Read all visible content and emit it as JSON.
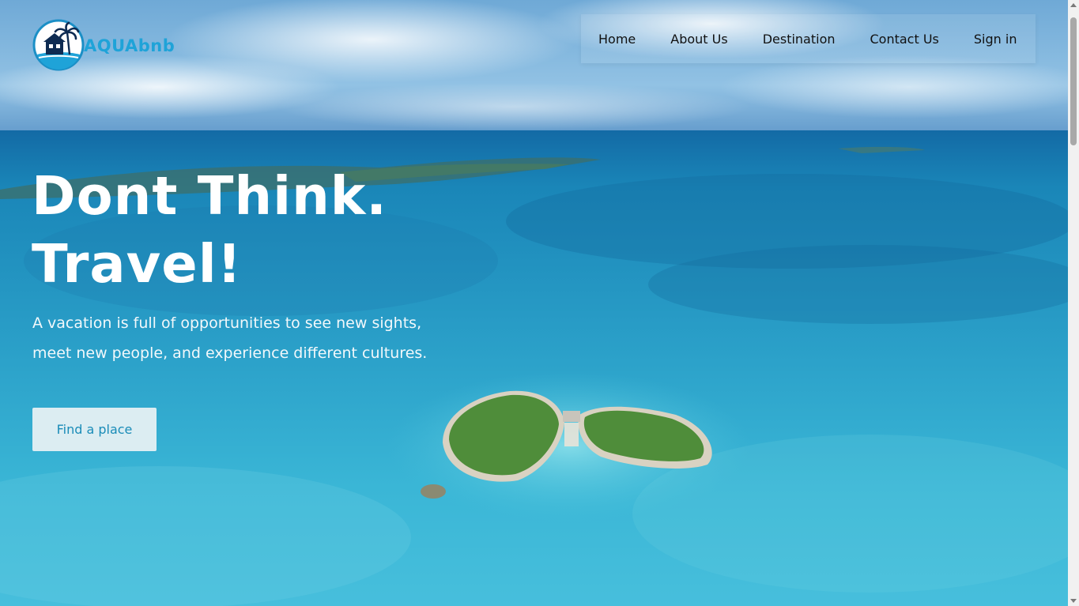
{
  "brand": {
    "name": "AQUAbnb",
    "logo_icon": "beach-house-icon",
    "color": "#1fa3d8"
  },
  "nav": {
    "items": [
      {
        "label": "Home"
      },
      {
        "label": "About Us"
      },
      {
        "label": "Destination"
      },
      {
        "label": "Contact Us"
      },
      {
        "label": "Sign in"
      }
    ]
  },
  "hero": {
    "headline_line1": "Dont Think.",
    "headline_line2": "Travel!",
    "subtitle_line1": "A vacation is full of opportunities to see new sights,",
    "subtitle_line2": "meet new people, and experience different cultures.",
    "cta_label": "Find a place",
    "background_image": "aerial-ocean-heart-island-photo"
  },
  "colors": {
    "sea": "#2aa6c8",
    "sky": "#7fb6dc",
    "cta_bg": "#dcedf2",
    "cta_text": "#1a8cb8"
  }
}
